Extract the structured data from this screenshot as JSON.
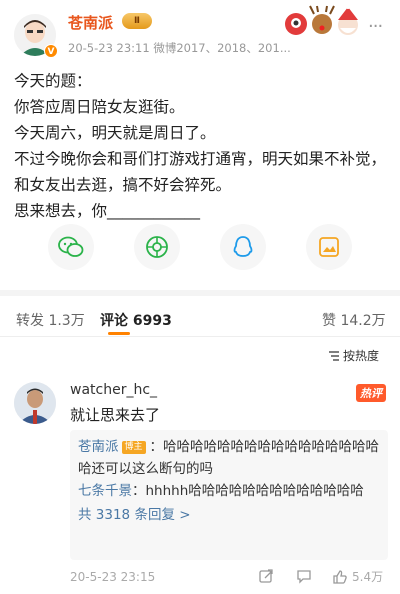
{
  "post": {
    "author": "苍南派",
    "crown_badge": "Ⅱ",
    "verified_badge": "V",
    "meta": "20-5-23 23:11  微博2017、2018、201...",
    "more_glyph": "···",
    "lines": [
      "今天的题：",
      "你答应周日陪女友逛街。",
      "今天周六，明天就是周日了。",
      "不过今晚你会和哥们打游戏打通宵，明天如果不补觉，和女友出去逛，搞不好会猝死。",
      "思来想去，你____________"
    ]
  },
  "share": {
    "icons": [
      "wechat-icon",
      "moments-icon",
      "qq-icon",
      "photo-card-icon"
    ]
  },
  "tabs": {
    "repost": "转发 1.3万",
    "comment": "评论 6993",
    "like": "赞 14.2万"
  },
  "sort": {
    "label": "按热度"
  },
  "comment": {
    "username": "watcher_hc_",
    "hot_tag": "热评",
    "text": "就让思来去了",
    "replies": [
      {
        "name": "苍南派",
        "badge": "博主",
        "text": "哈哈哈哈哈哈哈哈哈哈哈哈哈哈哈哈哈还可以这么断句的吗"
      },
      {
        "name": "七条千景",
        "text": "hhhhh哈哈哈哈哈哈哈哈哈哈哈哈哈"
      }
    ],
    "more_replies": "共 3318 条回复 >",
    "time": "20-5-23 23:15",
    "likes": "5.4万"
  },
  "colors": {
    "author": "#e8561d",
    "link": "#4a78a5",
    "accent": "#ff8200"
  }
}
